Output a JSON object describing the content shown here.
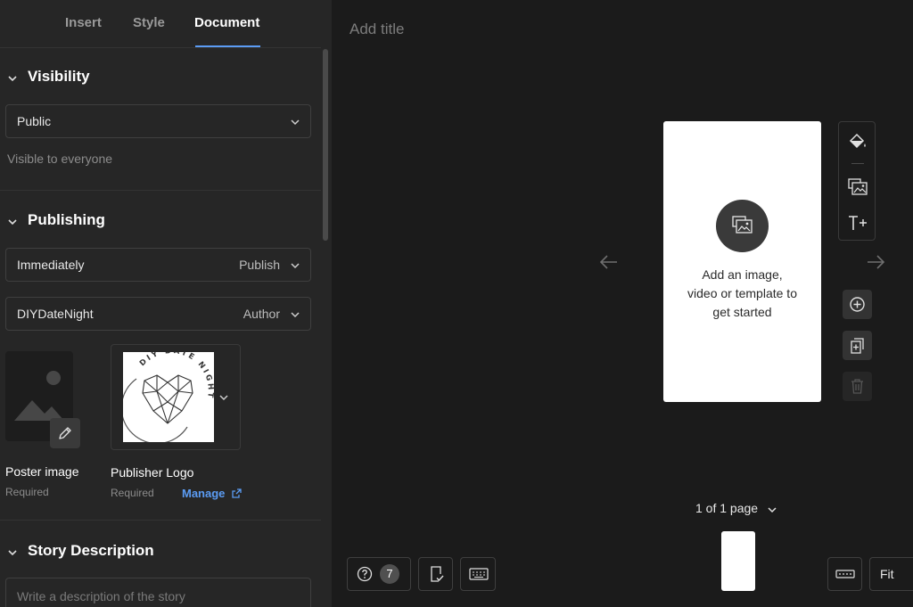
{
  "tabs": [
    {
      "label": "Insert",
      "active": false
    },
    {
      "label": "Style",
      "active": false
    },
    {
      "label": "Document",
      "active": true
    }
  ],
  "accent_color": "#5b9cf4",
  "visibility": {
    "title": "Visibility",
    "value": "Public",
    "helper": "Visible to everyone"
  },
  "publishing": {
    "title": "Publishing",
    "schedule": {
      "value": "Immediately",
      "label": "Publish"
    },
    "author": {
      "value": "DIYDateNight",
      "label": "Author"
    },
    "poster": {
      "label": "Poster image",
      "sub": "Required"
    },
    "logo": {
      "label": "Publisher Logo",
      "sub": "Required",
      "manage": "Manage",
      "logo_text": "DIY DATE NIGHT"
    }
  },
  "story_description": {
    "title": "Story Description",
    "placeholder": "Write a description of the story"
  },
  "editor": {
    "title_placeholder": "Add title",
    "empty_prompt": [
      "Add an image,",
      "video or template to",
      "get started"
    ],
    "page_indicator": "1 of 1 page",
    "checklist_count": "7",
    "zoom": "Fit"
  },
  "icons": {
    "toolbar": [
      "paint-bucket-icon",
      "media-icon",
      "text-add-icon"
    ],
    "page_actions": [
      "add-page-icon",
      "duplicate-page-icon",
      "delete-page-icon"
    ],
    "bottom_left": [
      "help-icon",
      "checklist-icon",
      "keyboard-icon"
    ],
    "bottom_right": [
      "grid-view-icon"
    ]
  }
}
